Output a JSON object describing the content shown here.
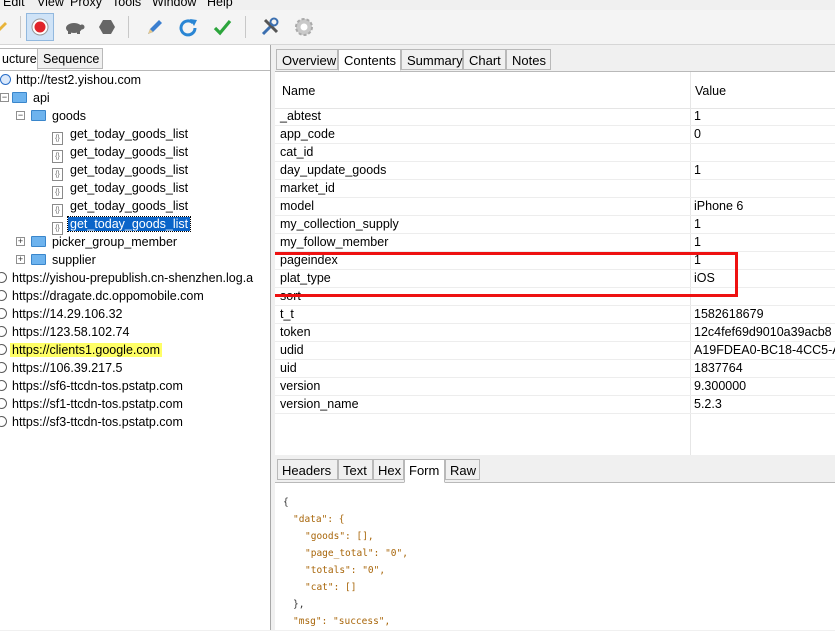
{
  "menu": [
    "Edit",
    "View",
    "Proxy",
    "Tools",
    "Window",
    "Help"
  ],
  "toolbar": {
    "icons": [
      "pencil-icon",
      "record-icon",
      "turtle-icon",
      "stop-hexagon-icon",
      "pen-icon",
      "refresh-icon",
      "check-icon",
      "tools-icon",
      "settings-icon"
    ],
    "accent_red": "#e0242a",
    "accent_blue": "#2a86d4",
    "accent_green": "#2ca53c"
  },
  "left_tabs": [
    "ucture",
    "Sequence"
  ],
  "tree": {
    "root": "http://test2.yishou.com",
    "api": "api",
    "goods": "goods",
    "goods_children": [
      "get_today_goods_list",
      "get_today_goods_list",
      "get_today_goods_list",
      "get_today_goods_list",
      "get_today_goods_list",
      "get_today_goods_list"
    ],
    "picker": "picker_group_member",
    "supplier": "supplier",
    "hosts": [
      "https://yishou-prepublish.cn-shenzhen.log.a",
      "https://dragate.dc.oppomobile.com",
      "https://14.29.106.32",
      "https://123.58.102.74",
      "https://clients1.google.com",
      "https://106.39.217.5",
      "https://sf6-ttcdn-tos.pstatp.com",
      "https://sf1-ttcdn-tos.pstatp.com",
      "https://sf3-ttcdn-tos.pstatp.com"
    ]
  },
  "right_tabs": [
    "Overview",
    "Contents",
    "Summary",
    "Chart",
    "Notes"
  ],
  "grid": {
    "header_name": "Name",
    "header_value": "Value",
    "rows": [
      {
        "k": "_abtest",
        "v": "1"
      },
      {
        "k": "app_code",
        "v": "0"
      },
      {
        "k": "cat_id",
        "v": ""
      },
      {
        "k": "day_update_goods",
        "v": "1"
      },
      {
        "k": "market_id",
        "v": ""
      },
      {
        "k": "model",
        "v": "iPhone 6"
      },
      {
        "k": "my_collection_supply",
        "v": "1"
      },
      {
        "k": "my_follow_member",
        "v": "1"
      },
      {
        "k": "pageindex",
        "v": "1"
      },
      {
        "k": "plat_type",
        "v": "iOS"
      },
      {
        "k": "sort",
        "v": ""
      },
      {
        "k": "t_t",
        "v": "1582618679"
      },
      {
        "k": "token",
        "v": "12c4fef69d9010a39acb8"
      },
      {
        "k": "udid",
        "v": "A19FDEA0-BC18-4CC5-A"
      },
      {
        "k": "uid",
        "v": "1837764"
      },
      {
        "k": "version",
        "v": "9.300000"
      },
      {
        "k": "version_name",
        "v": "5.2.3"
      }
    ]
  },
  "bottom_tabs": [
    "Headers",
    "Text",
    "Hex",
    "Form",
    "Raw"
  ],
  "json_lines": [
    {
      "t": "{"
    },
    {
      "t": "\"data\": {"
    },
    {
      "t": "\"goods\": [],"
    },
    {
      "t": "\"page_total\": \"0\","
    },
    {
      "t": "\"totals\": \"0\","
    },
    {
      "t": "\"cat\": []"
    },
    {
      "t": "},"
    },
    {
      "t": "\"msg\": \"success\","
    }
  ]
}
